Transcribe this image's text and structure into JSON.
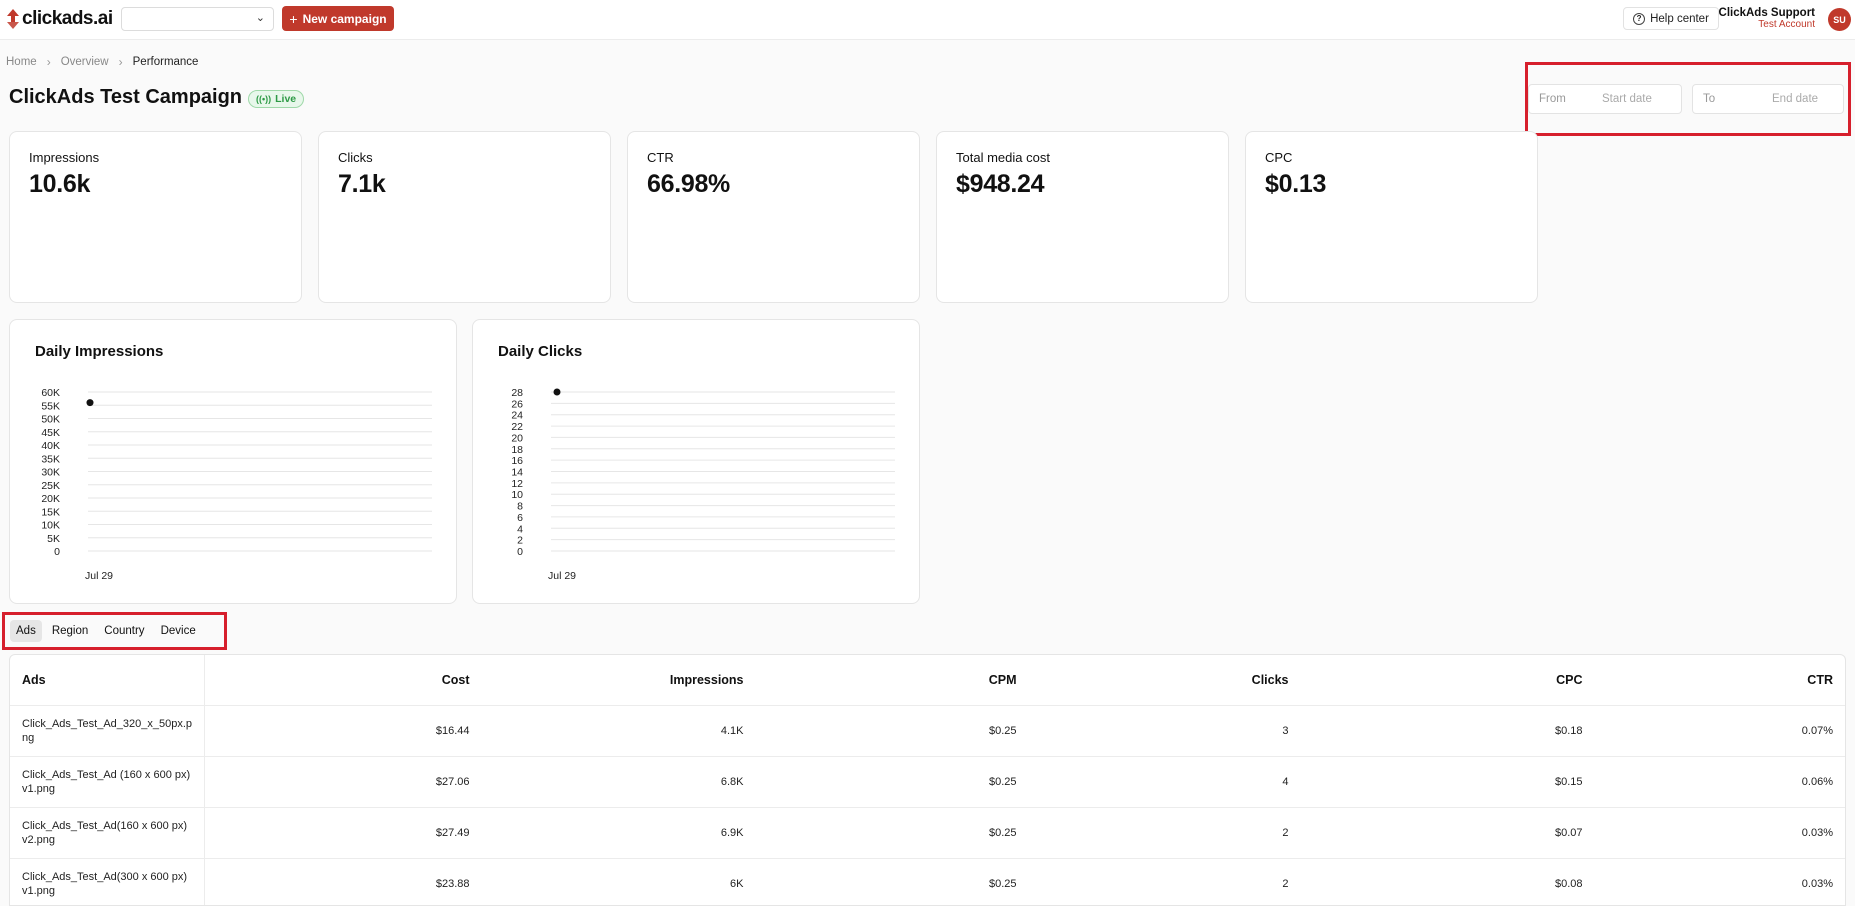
{
  "header": {
    "brand": "clickads.ai",
    "account_selector": {
      "value": ""
    },
    "new_campaign_label": "New campaign",
    "help_label": "Help center",
    "user_name": "ClickAds Support",
    "user_sub": "Test Account",
    "avatar_initials": "SU"
  },
  "breadcrumb": [
    "Home",
    "Overview",
    "Performance"
  ],
  "page": {
    "title": "ClickAds Test Campaign",
    "status": "Live"
  },
  "date_range": {
    "from_label": "From",
    "from_placeholder": "Start date",
    "to_label": "To",
    "to_placeholder": "End date"
  },
  "kpis": [
    {
      "label": "Impressions",
      "value": "10.6k"
    },
    {
      "label": "Clicks",
      "value": "7.1k"
    },
    {
      "label": "CTR",
      "value": "66.98%"
    },
    {
      "label": "Total media cost",
      "value": "$948.24"
    },
    {
      "label": "CPC",
      "value": "$0.13"
    }
  ],
  "chart_data": [
    {
      "type": "line",
      "title": "Daily Impressions",
      "x": [
        "Jul 29"
      ],
      "series": [
        {
          "values": [
            56000
          ]
        }
      ],
      "y_ticks": [
        "0",
        "5K",
        "10K",
        "15K",
        "20K",
        "25K",
        "30K",
        "35K",
        "40K",
        "45K",
        "50K",
        "55K",
        "60K"
      ],
      "ylim": [
        0,
        60000
      ],
      "grid": true
    },
    {
      "type": "line",
      "title": "Daily Clicks",
      "x": [
        "Jul 29"
      ],
      "series": [
        {
          "values": [
            28
          ]
        }
      ],
      "y_ticks": [
        "0",
        "2",
        "4",
        "6",
        "8",
        "10",
        "12",
        "14",
        "16",
        "18",
        "20",
        "22",
        "24",
        "26",
        "28"
      ],
      "ylim": [
        0,
        28
      ],
      "grid": true
    }
  ],
  "tabs": [
    "Ads",
    "Region",
    "Country",
    "Device"
  ],
  "active_tab": "Ads",
  "table": {
    "columns": [
      "Ads",
      "Cost",
      "Impressions",
      "CPM",
      "Clicks",
      "CPC",
      "CTR"
    ],
    "rows": [
      [
        "Click_Ads_Test_Ad_320_x_50px.p ng",
        "$16.44",
        "4.1K",
        "$0.25",
        "3",
        "$0.18",
        "0.07%"
      ],
      [
        "Click_Ads_Test_Ad (160 x 600 px) v1.png",
        "$27.06",
        "6.8K",
        "$0.25",
        "4",
        "$0.15",
        "0.06%"
      ],
      [
        "Click_Ads_Test_Ad(160 x 600 px) v2.png",
        "$27.49",
        "6.9K",
        "$0.25",
        "2",
        "$0.07",
        "0.03%"
      ],
      [
        "Click_Ads_Test_Ad(300 x 600 px) v1.png",
        "$23.88",
        "6K",
        "$0.25",
        "2",
        "$0.08",
        "0.03%"
      ]
    ]
  },
  "colors": {
    "brand_red": "#c0392b",
    "highlight_red": "#d61f2c",
    "live_green": "#2d9a45"
  }
}
